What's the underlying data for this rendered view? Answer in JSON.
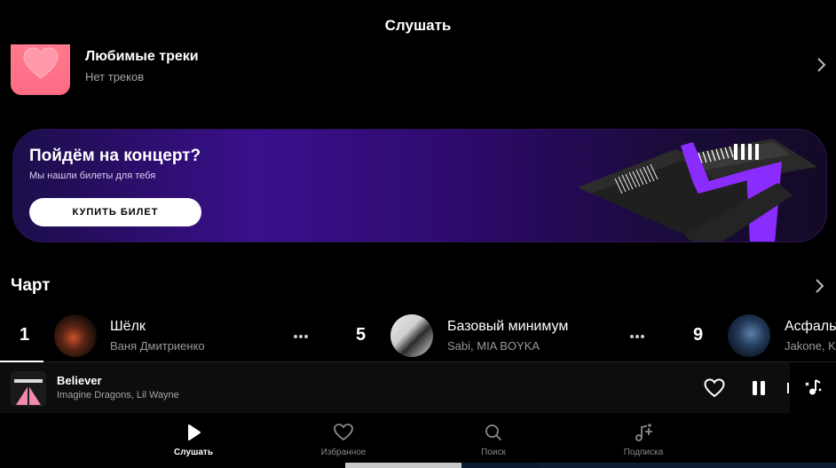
{
  "header": {
    "title": "Слушать"
  },
  "favorites": {
    "title": "Любимые треки",
    "subtitle": "Нет треков"
  },
  "banner": {
    "title": "Пойдём на концерт?",
    "subtitle": "Мы нашли билеты для тебя",
    "button_label": "КУПИТЬ БИЛЕТ",
    "accent_color": "#8b2cff"
  },
  "chart": {
    "title": "Чарт",
    "items": [
      {
        "rank": "1",
        "title": "Шёлк",
        "artist": "Ваня Дмитриенко"
      },
      {
        "rank": "5",
        "title": "Базовый минимум",
        "artist": "Sabi, MIA BOYKA"
      },
      {
        "rank": "9",
        "title": "Асфальт",
        "artist": "Jakone, Ki"
      }
    ]
  },
  "player": {
    "title": "Believer",
    "artist": "Imagine Dragons, Lil Wayne",
    "icons": [
      "heart-icon",
      "pause-icon",
      "music-wave-icon"
    ]
  },
  "nav": {
    "items": [
      {
        "label": "Слушать",
        "icon": "play-icon",
        "active": true
      },
      {
        "label": "Избранное",
        "icon": "heart-icon",
        "active": false
      },
      {
        "label": "Поиск",
        "icon": "search-icon",
        "active": false
      },
      {
        "label": "Подписка",
        "icon": "music-plus-icon",
        "active": false
      }
    ]
  }
}
